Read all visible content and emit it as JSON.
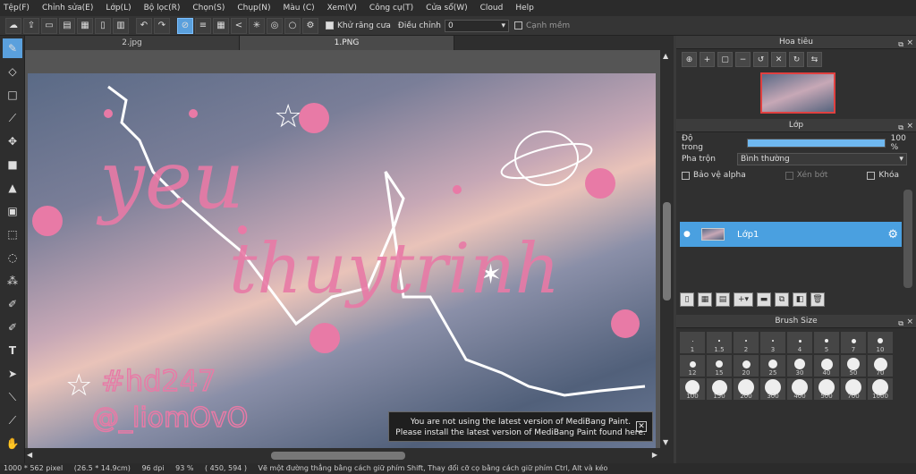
{
  "menu": [
    "Tệp(F)",
    "Chỉnh sửa(E)",
    "Lớp(L)",
    "Bộ lọc(R)",
    "Chọn(S)",
    "Chụp(N)",
    "Màu (C)",
    "Xem(V)",
    "Công cụ(T)",
    "Cửa sổ(W)",
    "Cloud",
    "Help"
  ],
  "toolbar": {
    "antialias_label": "Khử răng cưa",
    "adjust_label": "Điều chỉnh",
    "adjust_value": "0",
    "soft_edge_label": "Cạnh mềm"
  },
  "tabs": [
    "2.jpg",
    "1.PNG"
  ],
  "notification": {
    "line1": "You are not using the latest version of MediBang Paint.",
    "line2": "Please install the latest version of MediBang Paint found here.",
    "close": "✕"
  },
  "status": {
    "size": "1000 * 562 pixel",
    "physical": "(26.5 * 14.9cm)",
    "dpi": "96 dpi",
    "zoom": "93 %",
    "coords": "( 450, 594 )",
    "hint": "Vẽ một đường thẳng bằng cách giữ phím Shift, Thay đổi cỡ cọ bằng cách giữ phím Ctrl, Alt và kéo"
  },
  "navigator": {
    "title": "Hoa tiêu"
  },
  "layer_panel": {
    "title": "Lớp",
    "opacity_label": "Độ trong",
    "opacity_value": "100 %",
    "opacity": 1.0,
    "blend_label": "Pha trộn",
    "blend_value": "Bình thường",
    "protect_alpha": "Bảo vệ alpha",
    "clipping": "Xén bớt",
    "lock": "Khóa",
    "layer_name": "Lớp1"
  },
  "brush_panel": {
    "title": "Brush Size",
    "sizes": [
      "1",
      "1.5",
      "2",
      "3",
      "4",
      "5",
      "7",
      "10",
      "12",
      "15",
      "20",
      "25",
      "30",
      "40",
      "50",
      "70",
      "100",
      "150",
      "200",
      "300",
      "400",
      "500",
      "700",
      "1000"
    ]
  },
  "canvas_text": {
    "word1": "yeu",
    "word2": "thuytrinh",
    "tag1": "#hd247",
    "tag2": "@_liomOvO"
  },
  "colors": {
    "accent": "#5aa0dd",
    "pink": "#e87aa6"
  }
}
